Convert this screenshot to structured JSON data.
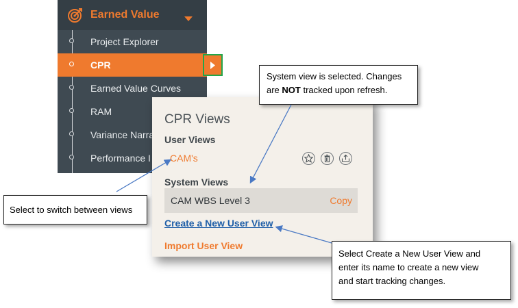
{
  "sidebar": {
    "header": {
      "title": "Earned Value",
      "icon": "target-icon"
    },
    "items": [
      {
        "label": "Project Explorer",
        "active": false
      },
      {
        "label": "CPR",
        "active": true
      },
      {
        "label": "Earned Value Curves",
        "active": false
      },
      {
        "label": "RAM",
        "active": false
      },
      {
        "label": "Variance Narra",
        "active": false
      },
      {
        "label": "Performance I",
        "active": false
      }
    ],
    "expand_icon": "chevron-right-icon"
  },
  "panel": {
    "title": "CPR Views",
    "user_views_heading": "User Views",
    "user_views": [
      {
        "name": "CAM's",
        "actions": [
          "star-icon",
          "trash-icon",
          "share-icon"
        ]
      }
    ],
    "system_views_heading": "System Views",
    "system_views": [
      {
        "name": "CAM WBS Level 3",
        "action": "Copy"
      }
    ],
    "create_link": "Create a New User View",
    "import_link": "Import User View"
  },
  "callouts": {
    "system_view": {
      "line1": "System view is selected. Changes",
      "line2_pre": "are ",
      "line2_bold": "NOT",
      "line2_post": " tracked upon refresh."
    },
    "switch": "Select to switch between views",
    "create": {
      "line1": "Select Create a New User View and",
      "line2": "enter its name to create a new view",
      "line3": "and start tracking changes."
    }
  },
  "colors": {
    "accent": "#ef7a2e",
    "sidebar_bg": "#3f4a52",
    "link": "#1f5fa8",
    "highlight_border": "#22a64a",
    "panel_bg": "#f4f0ea"
  }
}
